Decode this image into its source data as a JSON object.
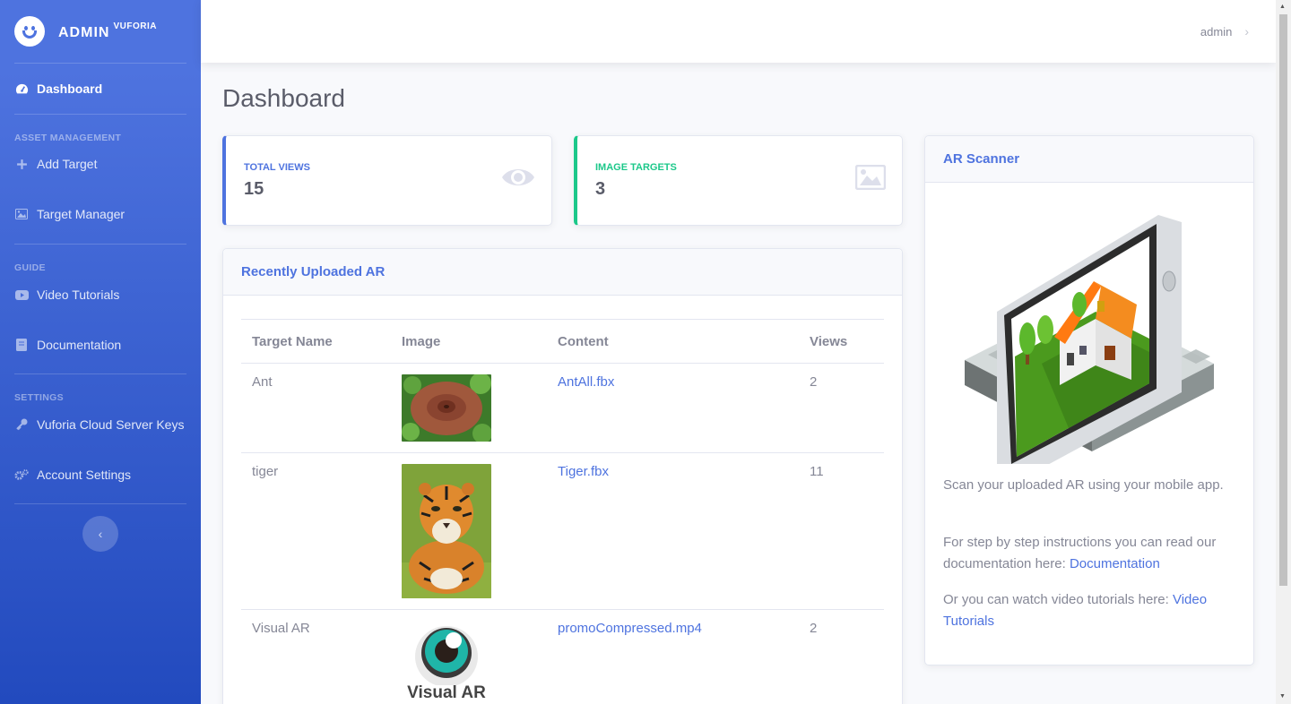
{
  "brand": {
    "name": "ADMIN",
    "sup": "VUFORIA"
  },
  "sidebar": {
    "dashboard": "Dashboard",
    "headings": [
      "ASSET MANAGEMENT",
      "GUIDE",
      "SETTINGS"
    ],
    "add_target": "Add Target",
    "target_manager": "Target Manager",
    "video_tutorials": "Video Tutorials",
    "documentation": "Documentation",
    "cloud_keys": "Vuforia Cloud Server Keys",
    "account_settings": "Account Settings",
    "toggle": "‹"
  },
  "topbar": {
    "user": "admin",
    "chevron": "›"
  },
  "page": {
    "title": "Dashboard"
  },
  "stats": [
    {
      "label": "TOTAL VIEWS",
      "value": "15",
      "icon": "eye-icon"
    },
    {
      "label": "IMAGE TARGETS",
      "value": "3",
      "icon": "image-icon"
    }
  ],
  "recent": {
    "title": "Recently Uploaded AR",
    "columns": [
      "Target Name",
      "Image",
      "Content",
      "Views"
    ],
    "rows": [
      {
        "name": "Ant",
        "content": "AntAll.fbx",
        "views": "2"
      },
      {
        "name": "tiger",
        "content": "Tiger.fbx",
        "views": "11"
      },
      {
        "name": "Visual AR",
        "content": "promoCompressed.mp4",
        "views": "2",
        "image_text": "Visual AR"
      }
    ]
  },
  "scanner": {
    "title": "AR Scanner",
    "p1": "Scan your uploaded AR using your mobile app.",
    "p2_prefix": "For step by step instructions you can read our documentation here:",
    "p2_link": "Documentation",
    "p3_prefix": "Or you can watch video tutorials here:",
    "p3_link": "Video Tutorials"
  },
  "colors": {
    "primary": "#4e73df",
    "success": "#1cc88a",
    "text": "#858796",
    "heading": "#5a5c69"
  }
}
